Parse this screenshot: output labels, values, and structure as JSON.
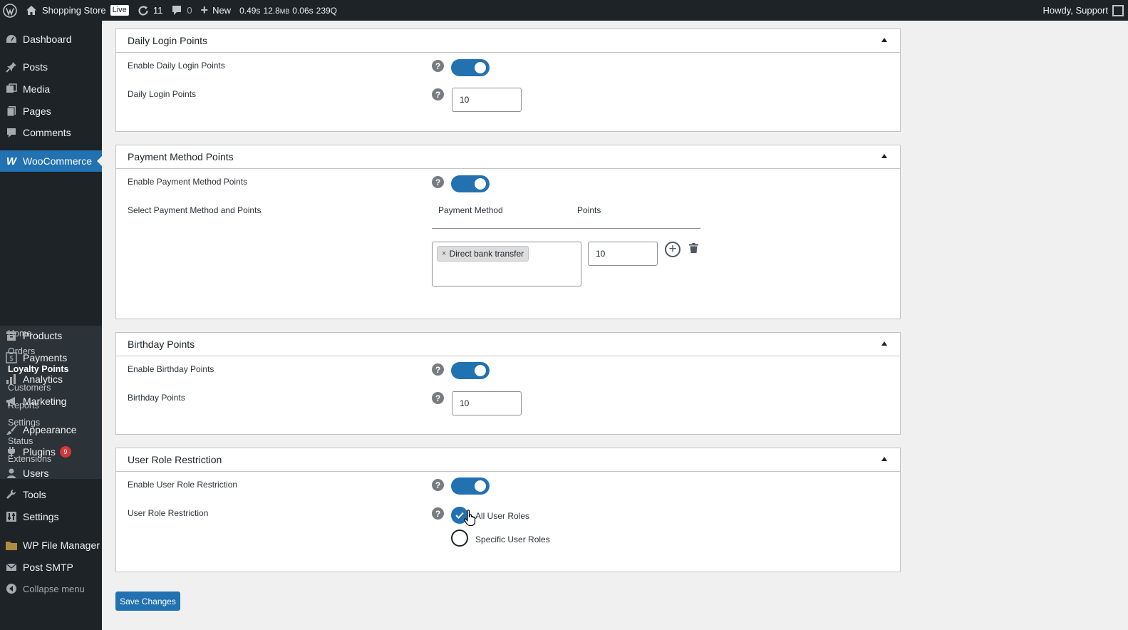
{
  "adminbar": {
    "site_name": "Shopping Store",
    "live_badge": "Live",
    "updates_count": "11",
    "comments_count": "0",
    "new_label": "New",
    "qm_time": "0.49s",
    "qm_memory": "12.8",
    "qm_memory_unit": "MB",
    "qm_db_time": "0.06s",
    "qm_queries": "239Q",
    "howdy": "Howdy, Support"
  },
  "sidebar": {
    "items": [
      {
        "label": "Dashboard",
        "icon": "dashboard-icon"
      },
      {
        "label": "Posts",
        "icon": "pushpin-icon"
      },
      {
        "label": "Media",
        "icon": "media-icon"
      },
      {
        "label": "Pages",
        "icon": "pages-icon"
      },
      {
        "label": "Comments",
        "icon": "comment-icon"
      },
      {
        "label": "WooCommerce",
        "icon": "woocommerce-icon"
      },
      {
        "label": "Products",
        "icon": "archive-icon"
      },
      {
        "label": "Payments",
        "icon": "dollar-icon"
      },
      {
        "label": "Analytics",
        "icon": "bar-chart-icon"
      },
      {
        "label": "Marketing",
        "icon": "megaphone-icon"
      },
      {
        "label": "Appearance",
        "icon": "paintbrush-icon"
      },
      {
        "label": "Plugins",
        "icon": "plugin-icon",
        "badge": "9"
      },
      {
        "label": "Users",
        "icon": "user-icon"
      },
      {
        "label": "Tools",
        "icon": "wrench-icon"
      },
      {
        "label": "Settings",
        "icon": "settings-icon"
      },
      {
        "label": "WP File Manager",
        "icon": "folder-icon"
      },
      {
        "label": "Post SMTP",
        "icon": "envelope-icon"
      },
      {
        "label": "Collapse menu",
        "icon": "collapse-icon"
      }
    ],
    "woocommerce_submenu": [
      "Home",
      "Orders",
      "Loyalty Points",
      "Customers",
      "Reports",
      "Settings",
      "Status",
      "Extensions"
    ],
    "current_submenu": "Loyalty Points"
  },
  "panels": {
    "daily_login": {
      "title": "Daily Login Points",
      "enable_label": "Enable Daily Login Points",
      "enabled": true,
      "points_label": "Daily Login Points",
      "points_value": "10"
    },
    "payment_method": {
      "title": "Payment Method Points",
      "enable_label": "Enable Payment Method Points",
      "enabled": true,
      "select_label": "Select Payment Method and Points",
      "col_method": "Payment Method",
      "col_points": "Points",
      "selected_methods": [
        "Direct bank transfer"
      ],
      "remove_chip_symbol": "×",
      "points_value": "10"
    },
    "birthday": {
      "title": "Birthday Points",
      "enable_label": "Enable Birthday Points",
      "enabled": true,
      "points_label": "Birthday Points",
      "points_value": "10"
    },
    "user_role": {
      "title": "User Role Restriction",
      "enable_label": "Enable User Role Restriction",
      "enabled": true,
      "restriction_label": "User Role Restriction",
      "options": [
        "All User Roles",
        "Specific User Roles"
      ],
      "selected_option": "All User Roles"
    }
  },
  "help_symbol": "?",
  "save_label": "Save Changes",
  "colors": {
    "accent": "#2271b1",
    "adminbar_bg": "#1d2327",
    "badge": "#d63638"
  }
}
